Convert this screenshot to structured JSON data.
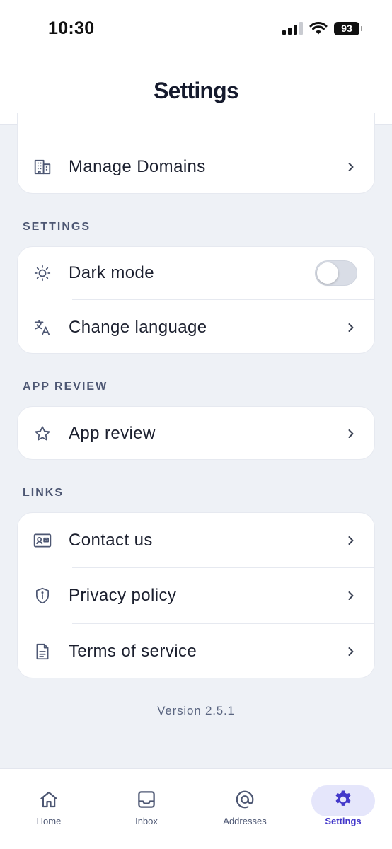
{
  "status_bar": {
    "time": "10:30",
    "battery": "93"
  },
  "header": {
    "title": "Settings"
  },
  "sections": {
    "settings_title": "SETTINGS",
    "app_review_title": "APP REVIEW",
    "links_title": "LINKS"
  },
  "account": {
    "manage_domains": "Manage Domains"
  },
  "settings": {
    "dark_mode": "Dark mode",
    "dark_mode_enabled": false,
    "change_language": "Change language"
  },
  "app_review": {
    "label": "App review"
  },
  "links": {
    "contact_us": "Contact us",
    "privacy_policy": "Privacy policy",
    "terms_of_service": "Terms of service"
  },
  "version": "Version 2.5.1",
  "nav": {
    "home": "Home",
    "inbox": "Inbox",
    "addresses": "Addresses",
    "settings": "Settings",
    "active": "settings"
  },
  "colors": {
    "accent": "#4338ca",
    "accent_bg": "#e5e6fb",
    "background": "#eef1f6",
    "section_text": "#4d5773"
  }
}
